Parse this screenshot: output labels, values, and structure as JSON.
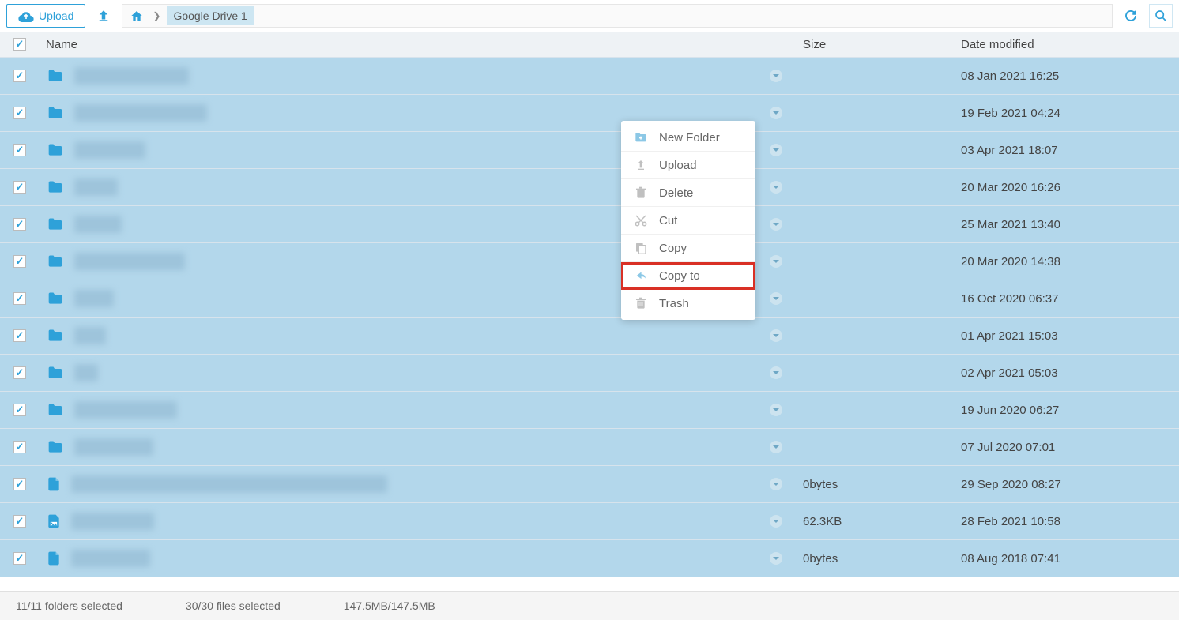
{
  "toolbar": {
    "upload_label": "Upload",
    "breadcrumb_current": "Google Drive 1"
  },
  "columns": {
    "name": "Name",
    "size": "Size",
    "date": "Date modified"
  },
  "files": [
    {
      "type": "folder",
      "blur_w": 145,
      "size": "",
      "date": "08 Jan 2021 16:25"
    },
    {
      "type": "folder",
      "blur_w": 168,
      "size": "",
      "date": "19 Feb 2021 04:24"
    },
    {
      "type": "folder",
      "blur_w": 90,
      "size": "",
      "date": "03 Apr 2021 18:07"
    },
    {
      "type": "folder",
      "blur_w": 55,
      "size": "",
      "date": "20 Mar 2020 16:26"
    },
    {
      "type": "folder",
      "blur_w": 60,
      "size": "",
      "date": "25 Mar 2021 13:40"
    },
    {
      "type": "folder",
      "blur_w": 140,
      "size": "",
      "date": "20 Mar 2020 14:38"
    },
    {
      "type": "folder",
      "blur_w": 50,
      "size": "",
      "date": "16 Oct 2020 06:37"
    },
    {
      "type": "folder",
      "blur_w": 40,
      "size": "",
      "date": "01 Apr 2021 15:03"
    },
    {
      "type": "folder",
      "blur_w": 30,
      "size": "",
      "date": "02 Apr 2021 05:03"
    },
    {
      "type": "folder",
      "blur_w": 130,
      "size": "",
      "date": "19 Jun 2020 06:27"
    },
    {
      "type": "folder",
      "blur_w": 100,
      "size": "",
      "date": "07 Jul 2020 07:01"
    },
    {
      "type": "file",
      "blur_w": 400,
      "size": "0bytes",
      "date": "29 Sep 2020 08:27"
    },
    {
      "type": "image",
      "blur_w": 105,
      "size": "62.3KB",
      "date": "28 Feb 2021 10:58"
    },
    {
      "type": "file",
      "blur_w": 100,
      "size": "0bytes",
      "date": "08 Aug 2018 07:41"
    }
  ],
  "context_menu": [
    {
      "icon": "new-folder-icon",
      "label": "New Folder"
    },
    {
      "icon": "upload-icon",
      "label": "Upload"
    },
    {
      "icon": "delete-icon",
      "label": "Delete"
    },
    {
      "icon": "cut-icon",
      "label": "Cut"
    },
    {
      "icon": "copy-icon",
      "label": "Copy"
    },
    {
      "icon": "copy-to-icon",
      "label": "Copy to",
      "highlighted": true
    },
    {
      "icon": "trash-icon",
      "label": "Trash"
    }
  ],
  "status": {
    "folders": "11/11 folders selected",
    "files": "30/30 files selected",
    "size": "147.5MB/147.5MB"
  }
}
